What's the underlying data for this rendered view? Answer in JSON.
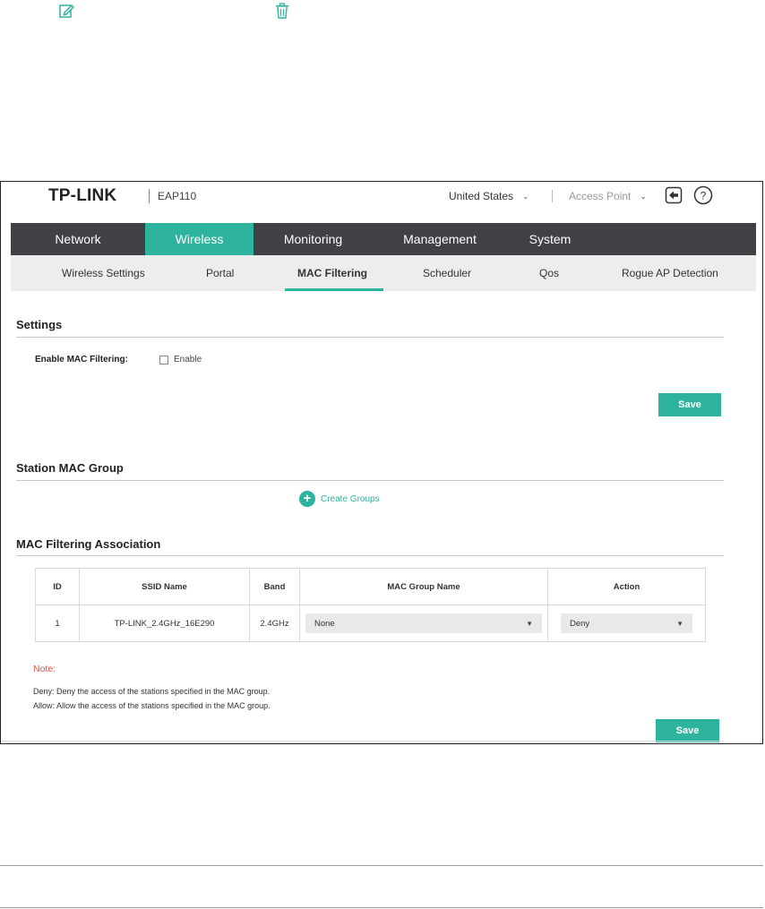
{
  "header": {
    "logo": "TP-LINK",
    "model": "EAP110",
    "country": "United States",
    "mode": "Access Point"
  },
  "main_nav": [
    {
      "label": "Network"
    },
    {
      "label": "Wireless"
    },
    {
      "label": "Monitoring"
    },
    {
      "label": "Management"
    },
    {
      "label": "System"
    }
  ],
  "sub_nav": [
    {
      "label": "Wireless Settings"
    },
    {
      "label": "Portal"
    },
    {
      "label": "MAC Filtering"
    },
    {
      "label": "Scheduler"
    },
    {
      "label": "Qos"
    },
    {
      "label": "Rogue AP Detection"
    }
  ],
  "settings": {
    "title": "Settings",
    "field_label": "Enable MAC Filtering:",
    "checkbox_label": "Enable",
    "checked": false,
    "save_label": "Save"
  },
  "station_group": {
    "title": "Station MAC Group",
    "create_label": "Create Groups"
  },
  "association": {
    "title": "MAC Filtering Association",
    "columns": [
      "ID",
      "SSID Name",
      "Band",
      "MAC Group Name",
      "Action"
    ],
    "rows": [
      {
        "id": "1",
        "ssid": "TP-LINK_2.4GHz_16E290",
        "band": "2.4GHz",
        "group": "None",
        "action": "Deny"
      }
    ]
  },
  "note": {
    "title": "Note:",
    "lines": [
      "Deny: Deny the access of the stations specified in the MAC group.",
      "Allow: Allow the access of the stations specified in the MAC group."
    ],
    "save_label": "Save"
  },
  "colors": {
    "accent": "#2db39e",
    "nav_bg": "#3f4145",
    "subnav_bg": "#ededed",
    "note_red": "#e0533d"
  },
  "icons": {
    "edit": "edit-icon",
    "delete": "trash-icon",
    "logout": "logout-icon",
    "help": "help-icon",
    "add": "plus-circle-icon"
  }
}
